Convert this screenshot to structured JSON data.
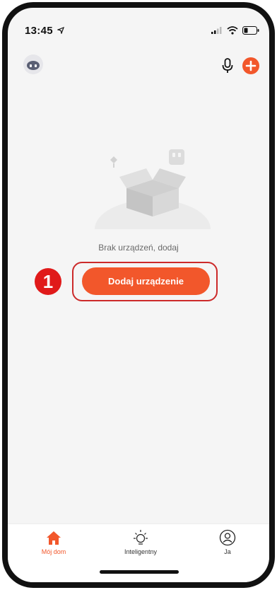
{
  "status_bar": {
    "time": "13:45",
    "icons": [
      "location-arrow-icon",
      "signal-icon",
      "wifi-icon",
      "battery-icon"
    ]
  },
  "topbar": {
    "avatar_icon": "robot-avatar-icon",
    "mic_icon": "microphone-icon",
    "add_icon": "plus-icon"
  },
  "main": {
    "empty_text": "Brak urządzeń, dodaj",
    "add_button_label": "Dodaj urządzenie",
    "step_number": "1"
  },
  "tabbar": {
    "tabs": [
      {
        "label": "Mój dom",
        "icon": "home-icon",
        "active": true
      },
      {
        "label": "Inteligentny",
        "icon": "sun-icon",
        "active": false
      },
      {
        "label": "Ja",
        "icon": "user-icon",
        "active": false
      }
    ]
  },
  "colors": {
    "accent": "#f2572b",
    "highlight": "#cc2a2a",
    "step_badge": "#e01a1a",
    "background": "#f5f5f5"
  }
}
